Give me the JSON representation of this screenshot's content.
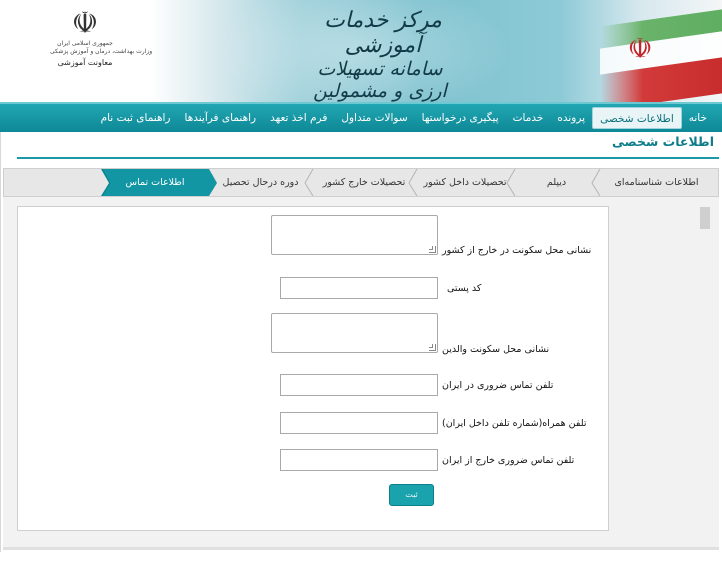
{
  "header": {
    "title_line1": "مرکز خدمات آموزشی",
    "title_line2": "سامانه تسهیلات ارزی و مشمولین",
    "emblem_symbol": "☫",
    "emblem_text_1": "جمهوری اسلامی ایران",
    "emblem_text_2": "وزارت بهداشت، درمان و آموزش پزشکی",
    "emblem_text_3": "معاونت آموزشی"
  },
  "nav": {
    "items": [
      {
        "label": "خانه"
      },
      {
        "label": "اطلاعات شخصی",
        "active": true
      },
      {
        "label": "پرونده"
      },
      {
        "label": "خدمات"
      },
      {
        "label": "پیگیری درخواستها"
      },
      {
        "label": "سوالات متداول"
      },
      {
        "label": "فرم اخذ تعهد"
      },
      {
        "label": "راهنمای فرآیندها"
      },
      {
        "label": "راهنمای ثبت نام"
      }
    ]
  },
  "page": {
    "title": "اطلاعات شخصی"
  },
  "tabs": [
    {
      "label": "اطلاعات شناسنامه‌ای"
    },
    {
      "label": "دیپلم"
    },
    {
      "label": "تحصیلات داخل کشور"
    },
    {
      "label": "تحصیلات خارج کشور"
    },
    {
      "label": "دوره درحال تحصیل"
    },
    {
      "label": "اطلاعات تماس",
      "active": true
    }
  ],
  "form": {
    "address_abroad_label": "نشانی محل سکونت در خارج از کشور",
    "address_abroad_value": "",
    "postal_code_label": "کد پستی",
    "postal_code_value": "",
    "parents_address_label": "نشانی محل سکونت والدین",
    "parents_address_value": "",
    "emergency_phone_iran_label": "تلفن تماس ضروری در ایران",
    "emergency_phone_iran_value": "",
    "mobile_label": "تلفن همراه(شماره تلفن داخل ایران)",
    "mobile_value": "",
    "emergency_phone_abroad_label": "تلفن تماس ضروری خارج از ایران",
    "emergency_phone_abroad_value": "",
    "submit_label": "ثبت"
  },
  "colors": {
    "accent": "#1296a3",
    "nav_bg": "#0e8896",
    "title": "#0e7d8a"
  }
}
